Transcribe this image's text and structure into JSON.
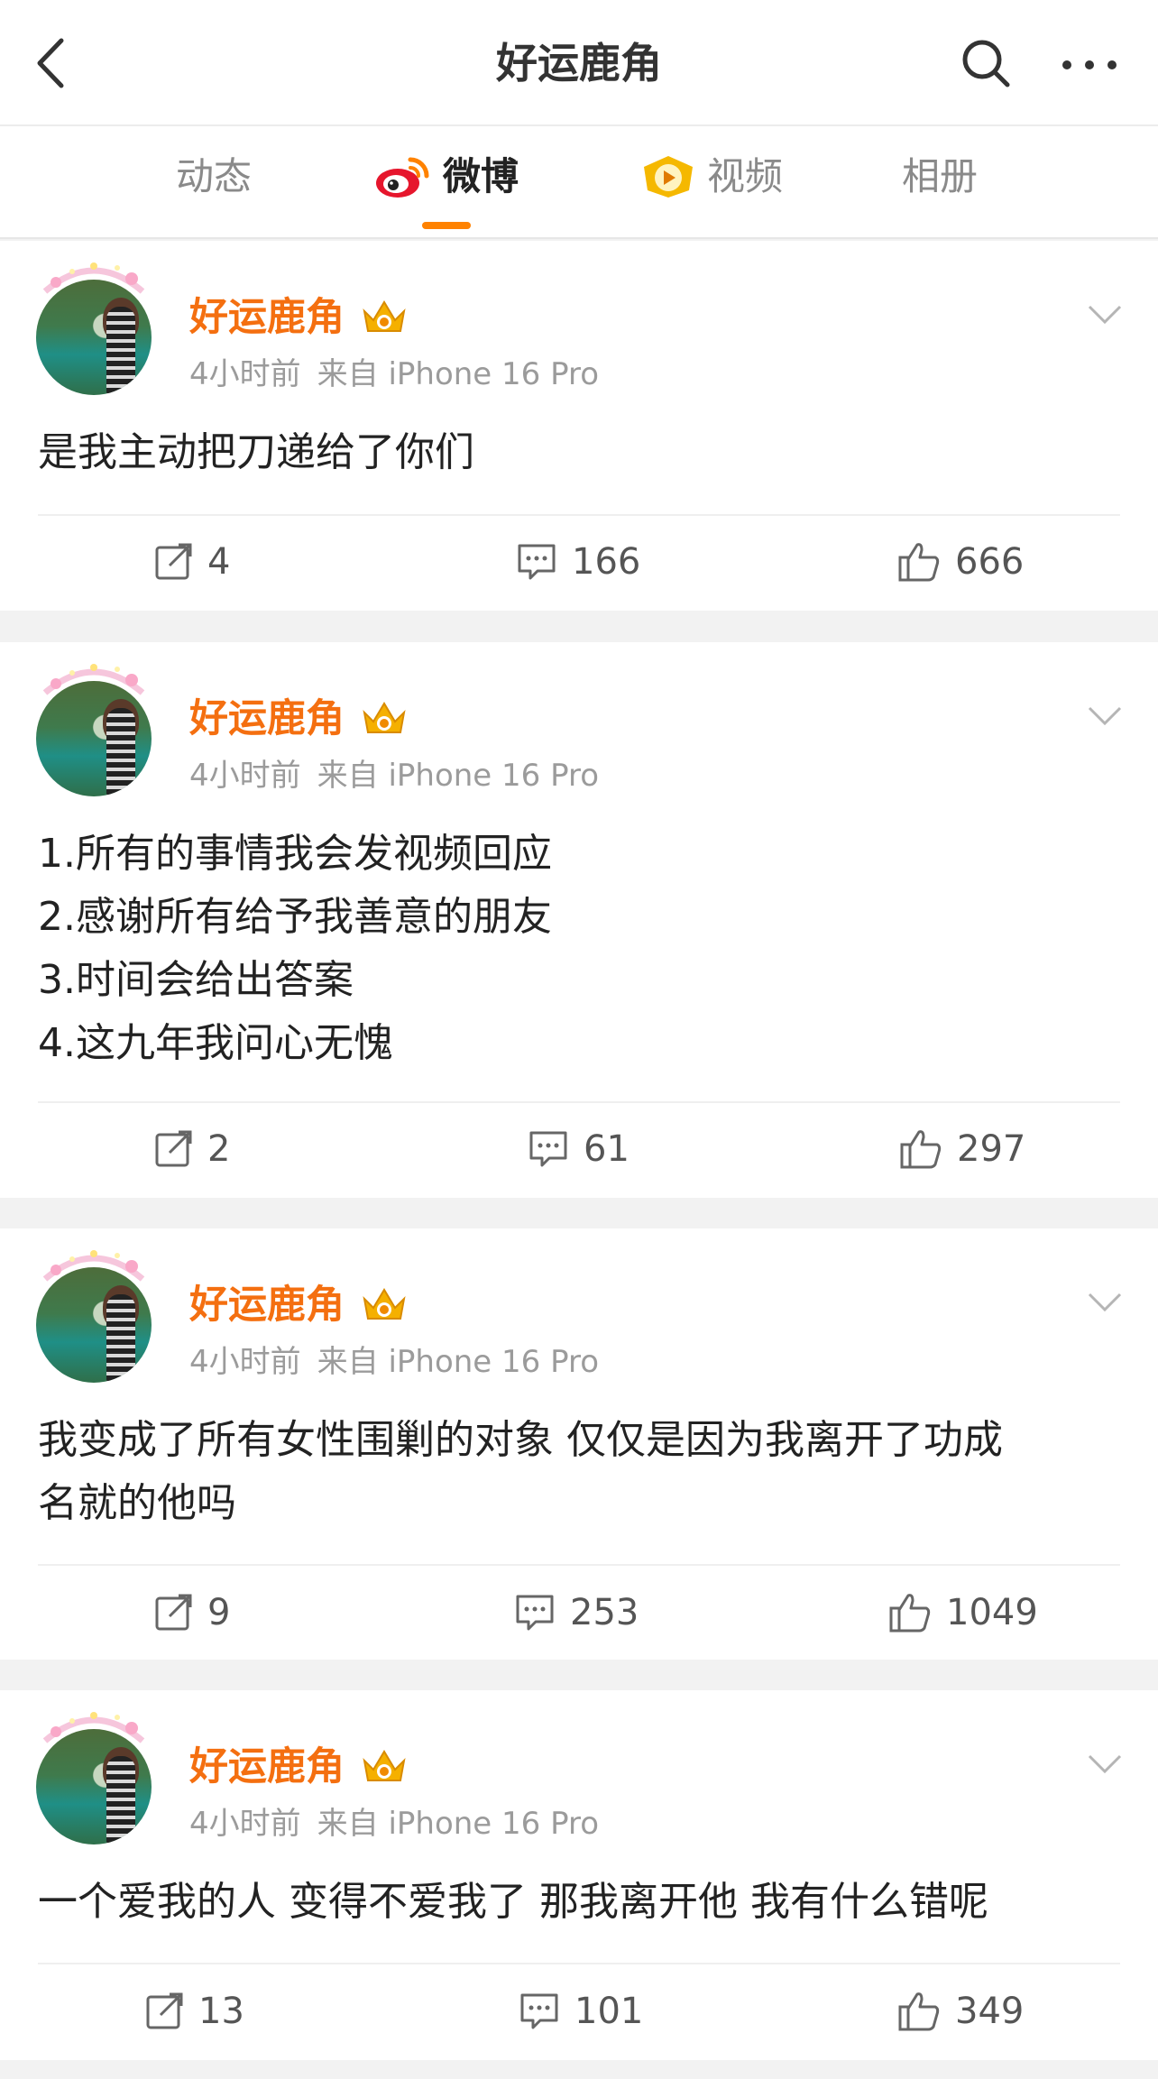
{
  "header": {
    "title": "好运鹿角"
  },
  "tabs": [
    {
      "label": "动态",
      "active": false
    },
    {
      "label": "微博",
      "active": true
    },
    {
      "label": "视频",
      "active": false
    },
    {
      "label": "相册",
      "active": false
    }
  ],
  "colors": {
    "accent": "#ff8200",
    "username": "#f46f10",
    "meta": "#9b9b9b"
  },
  "posts": [
    {
      "username": "好运鹿角",
      "time": "4小时前",
      "source": "来自 iPhone 16 Pro",
      "text": "是我主动把刀递给了你们",
      "reposts": "4",
      "comments": "166",
      "likes": "666"
    },
    {
      "username": "好运鹿角",
      "time": "4小时前",
      "source": "来自 iPhone 16 Pro",
      "text": "1.所有的事情我会发视频回应\n2.感谢所有给予我善意的朋友\n3.时间会给出答案\n4.这九年我问心无愧",
      "reposts": "2",
      "comments": "61",
      "likes": "297"
    },
    {
      "username": "好运鹿角",
      "time": "4小时前",
      "source": "来自 iPhone 16 Pro",
      "text": "我变成了所有女性围剿的对象 仅仅是因为我离开了功成\n名就的他吗",
      "reposts": "9",
      "comments": "253",
      "likes": "1049"
    },
    {
      "username": "好运鹿角",
      "time": "4小时前",
      "source": "来自 iPhone 16 Pro",
      "text": "一个爱我的人 变得不爱我了 那我离开他 我有什么错呢",
      "reposts": "13",
      "comments": "101",
      "likes": "349"
    }
  ]
}
